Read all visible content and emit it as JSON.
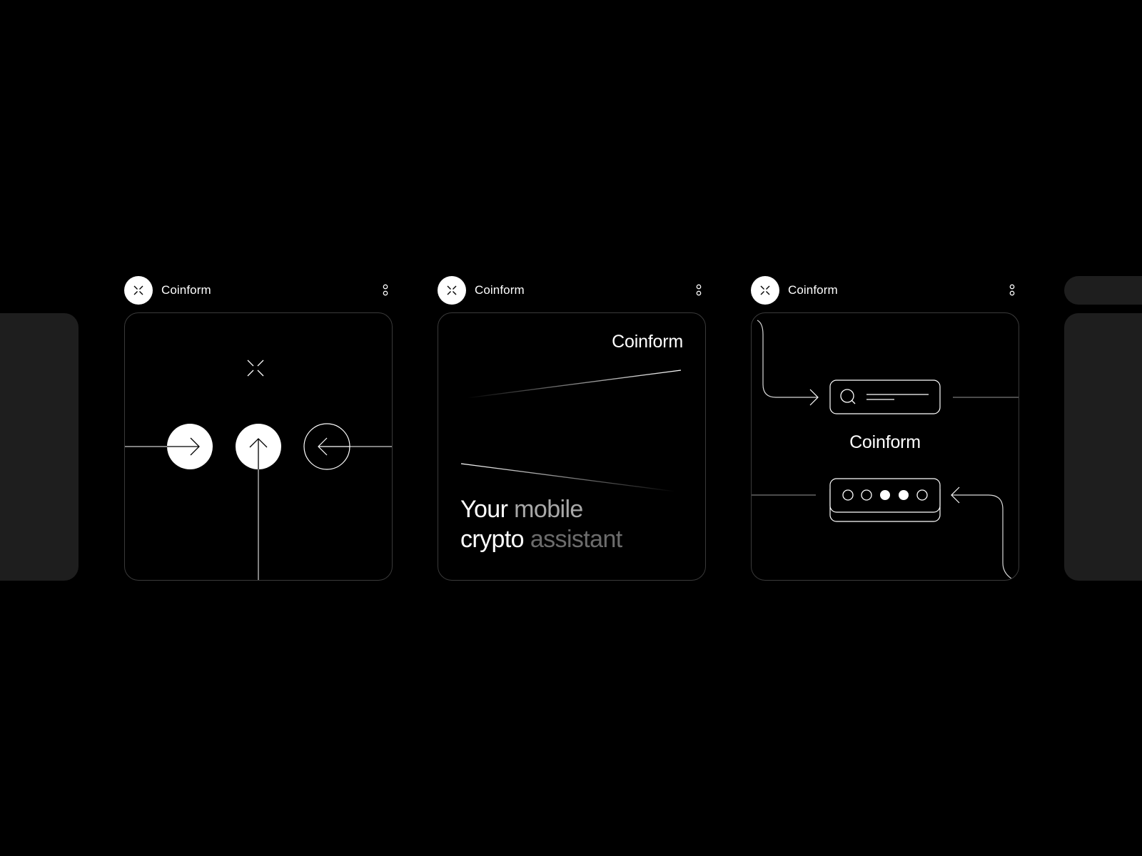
{
  "posts": [
    {
      "author": "Coinform",
      "avatar_icon": "coinform-logo-icon",
      "menu_icon": "more-vertical-icon",
      "card": {
        "art": [
          "coinform-mark-icon",
          "arrow-right-icon",
          "arrow-up-icon",
          "arrow-left-icon"
        ]
      }
    },
    {
      "author": "Coinform",
      "avatar_icon": "coinform-logo-icon",
      "menu_icon": "more-vertical-icon",
      "card": {
        "brand": "Coinform",
        "tagline": {
          "line1_a": "Your ",
          "line1_b": "mobile",
          "line2_a": "crypto ",
          "line2_b": "assistant"
        }
      }
    },
    {
      "author": "Coinform",
      "avatar_icon": "coinform-logo-icon",
      "menu_icon": "more-vertical-icon",
      "card": {
        "brand": "Coinform",
        "art": [
          "search-icon",
          "arrow-right-icon",
          "arrow-left-icon",
          "pin-dots-icon"
        ]
      }
    }
  ],
  "colors": {
    "background": "#000000",
    "card_border": "#3a3a3a",
    "ghost_card": "#1e1e1e",
    "accent": "#ffffff"
  }
}
